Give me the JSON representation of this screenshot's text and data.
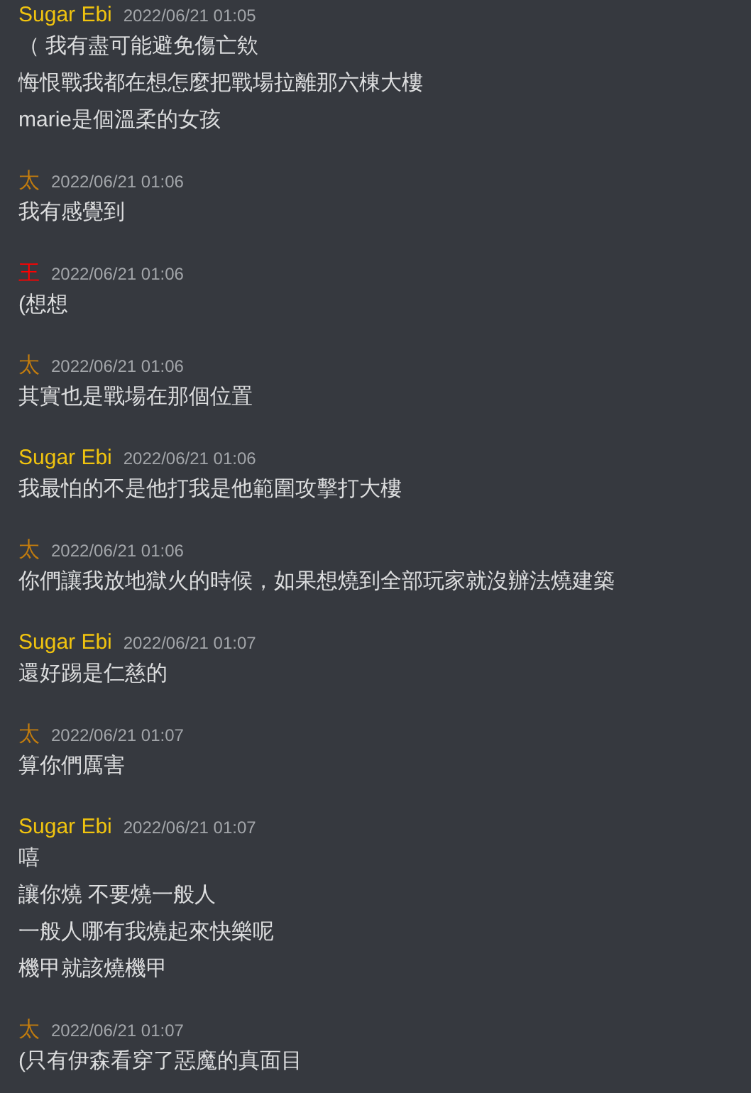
{
  "messages": [
    {
      "author": "Sugar Ebi",
      "color": "#f1c40f",
      "time": "2022/06/21 01:05",
      "lines": [
        "（ 我有盡可能避免傷亡欸",
        "悔恨戰我都在想怎麼把戰場拉離那六棟大樓",
        "marie是個溫柔的女孩"
      ]
    },
    {
      "author": "太",
      "color": "#c27c0e",
      "time": "2022/06/21 01:06",
      "lines": [
        "我有感覺到"
      ]
    },
    {
      "author": "王",
      "color": "#ff0000",
      "time": "2022/06/21 01:06",
      "lines": [
        "(想想"
      ]
    },
    {
      "author": "太",
      "color": "#c27c0e",
      "time": "2022/06/21 01:06",
      "lines": [
        "其實也是戰場在那個位置"
      ]
    },
    {
      "author": "Sugar Ebi",
      "color": "#f1c40f",
      "time": "2022/06/21 01:06",
      "lines": [
        "我最怕的不是他打我是他範圍攻擊打大樓"
      ]
    },
    {
      "author": "太",
      "color": "#c27c0e",
      "time": "2022/06/21 01:06",
      "lines": [
        "你們讓我放地獄火的時候，如果想燒到全部玩家就沒辦法燒建築"
      ]
    },
    {
      "author": "Sugar Ebi",
      "color": "#f1c40f",
      "time": "2022/06/21 01:07",
      "lines": [
        "還好踢是仁慈的"
      ]
    },
    {
      "author": "太",
      "color": "#c27c0e",
      "time": "2022/06/21 01:07",
      "lines": [
        "算你們厲害"
      ]
    },
    {
      "author": "Sugar Ebi",
      "color": "#f1c40f",
      "time": "2022/06/21 01:07",
      "lines": [
        "嘻",
        "讓你燒 不要燒一般人",
        "一般人哪有我燒起來快樂呢",
        "機甲就該燒機甲"
      ]
    },
    {
      "author": "太",
      "color": "#c27c0e",
      "time": "2022/06/21 01:07",
      "lines": [
        "(只有伊森看穿了惡魔的真面目"
      ]
    }
  ]
}
